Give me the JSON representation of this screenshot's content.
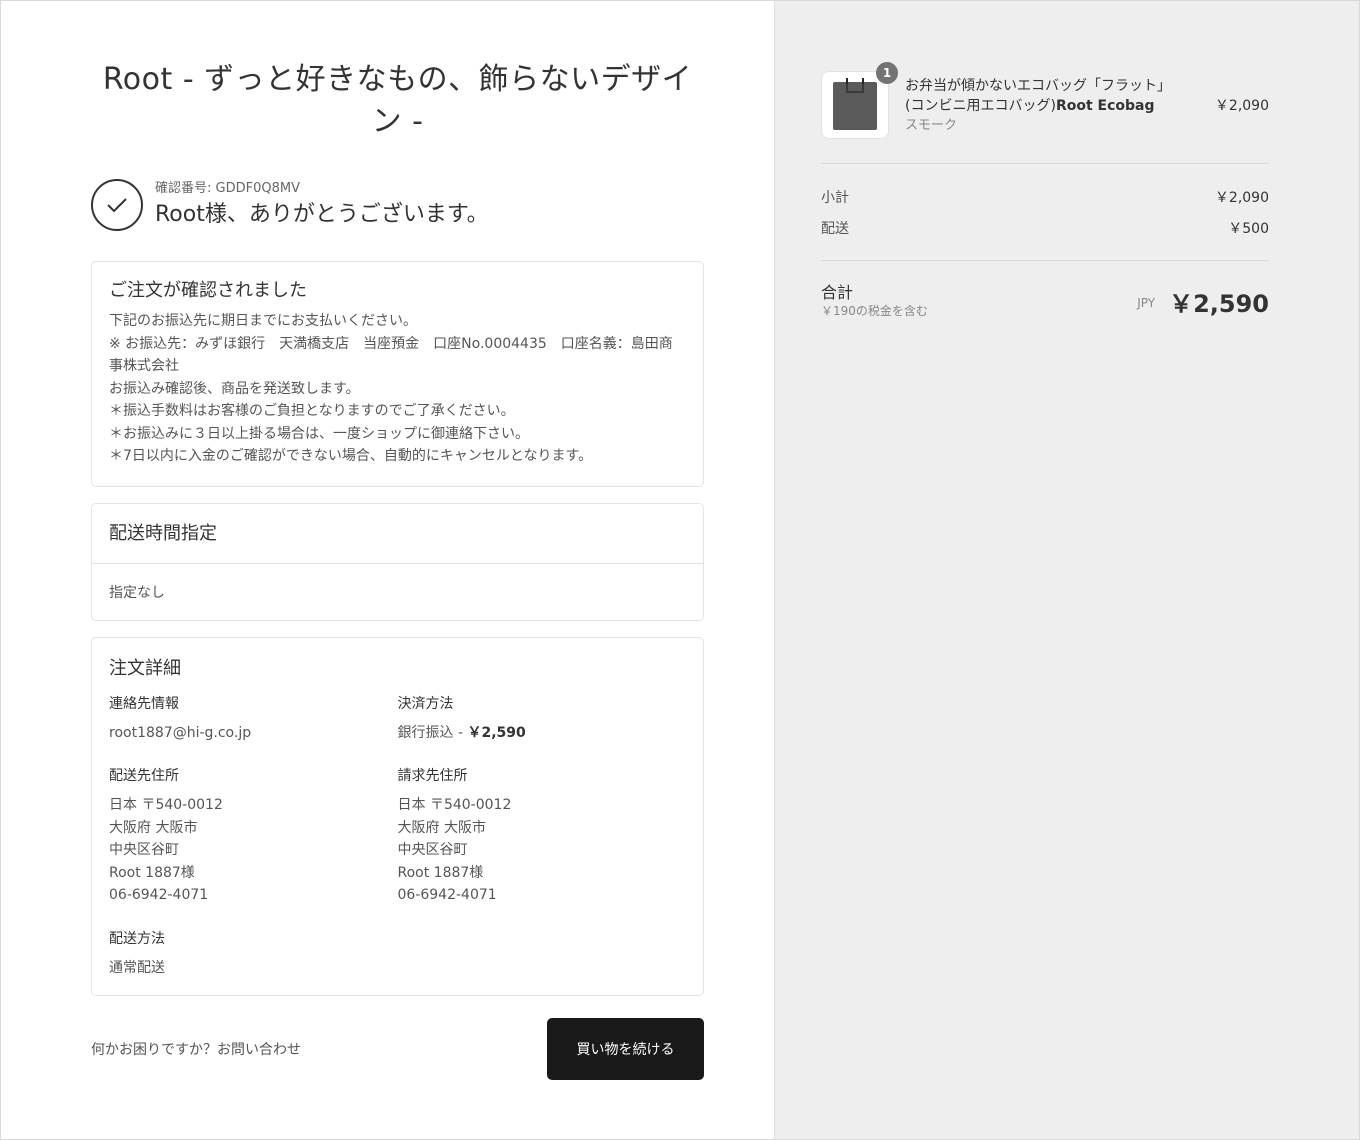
{
  "shop": {
    "title": "Root - ずっと好きなもの、飾らないデザイン -"
  },
  "confirmation": {
    "number_label": "確認番号: GDDF0Q8MV",
    "thanks": "Root様、ありがとうございます。"
  },
  "order_confirmed": {
    "title": "ご注文が確認されました",
    "lines": [
      "下記のお振込先に期日までにお支払いください。",
      "※ お振込先：みずほ銀行　天満橋支店　当座預金　口座No.0004435　口座名義：島田商事株式会社",
      "お振込み確認後、商品を発送致します。",
      "＊振込手数料はお客様のご負担となりますのでご了承ください。",
      "＊お振込みに３日以上掛る場合は、一度ショップに御連絡下さい。",
      "＊7日以内に入金のご確認ができない場合、自動的にキャンセルとなります。"
    ]
  },
  "delivery_time": {
    "title": "配送時間指定",
    "value": "指定なし"
  },
  "order_details": {
    "title": "注文詳細",
    "contact_label": "連絡先情報",
    "contact_value": "root1887@hi-g.co.jp",
    "payment_label": "決済方法",
    "payment_method": "銀行振込 - ",
    "payment_amount": "￥2,590",
    "shipping_address_label": "配送先住所",
    "shipping_address": [
      "日本 〒540-0012",
      "大阪府 大阪市",
      "中央区谷町",
      "Root 1887様",
      "06-6942-4071"
    ],
    "billing_address_label": "請求先住所",
    "billing_address": [
      "日本 〒540-0012",
      "大阪府 大阪市",
      "中央区谷町",
      "Root 1887様",
      "06-6942-4071"
    ],
    "shipping_method_label": "配送方法",
    "shipping_method": "通常配送"
  },
  "footer": {
    "help_text": "何かお困りですか？",
    "contact_link": "お問い合わせ",
    "continue_button": "買い物を続ける"
  },
  "summary": {
    "product": {
      "quantity": "1",
      "name_prefix": "お弁当が傾かないエコバッグ「フラット」(コンビニ用エコバッグ)",
      "name_bold": "Root Ecobag",
      "variant": "スモーク",
      "price": "￥2,090"
    },
    "subtotal_label": "小計",
    "subtotal": "￥2,090",
    "shipping_label": "配送",
    "shipping": "￥500",
    "total_label": "合計",
    "tax_note": "￥190の税金を含む",
    "currency": "JPY",
    "total": "￥2,590"
  },
  "colors": {
    "sidebar_bg": "#eeeeee",
    "button_bg": "#1a1a1a",
    "badge_bg": "#737373"
  }
}
